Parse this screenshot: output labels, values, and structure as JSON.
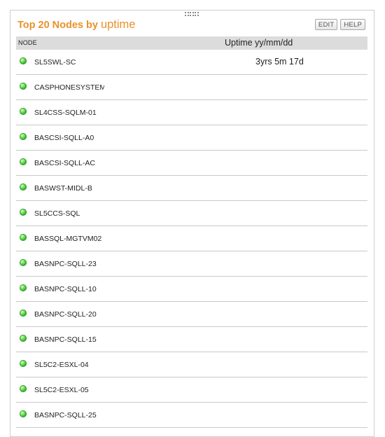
{
  "widget": {
    "title_bold": "Top 20 Nodes by",
    "title_metric": "uptime",
    "edit_label": "EDIT",
    "help_label": "HELP"
  },
  "table": {
    "col_node": "NODE",
    "col_uptime": "Uptime  yy/mm/dd",
    "status_icon": "green-status-dot",
    "colors": {
      "title": "#e8922b",
      "header_bg": "#dcdcdc",
      "status_up": "#2db22d"
    },
    "rows": [
      {
        "node": "SL5SWL-SC",
        "uptime": "3yrs 5m 17d"
      },
      {
        "node": "CASPHONESYSTEM",
        "uptime": ""
      },
      {
        "node": "SL4CSS-SQLM-01",
        "uptime": ""
      },
      {
        "node": "BASCSI-SQLL-A0",
        "uptime": ""
      },
      {
        "node": "BASCSI-SQLL-AC",
        "uptime": ""
      },
      {
        "node": "BASWST-MIDL-B",
        "uptime": ""
      },
      {
        "node": "SL5CCS-SQL",
        "uptime": ""
      },
      {
        "node": "BASSQL-MGTVM02",
        "uptime": ""
      },
      {
        "node": "BASNPC-SQLL-23",
        "uptime": ""
      },
      {
        "node": "BASNPC-SQLL-10",
        "uptime": ""
      },
      {
        "node": "BASNPC-SQLL-20",
        "uptime": ""
      },
      {
        "node": "BASNPC-SQLL-15",
        "uptime": ""
      },
      {
        "node": "SL5C2-ESXL-04",
        "uptime": ""
      },
      {
        "node": "SL5C2-ESXL-05",
        "uptime": ""
      },
      {
        "node": "BASNPC-SQLL-25",
        "uptime": ""
      }
    ]
  }
}
